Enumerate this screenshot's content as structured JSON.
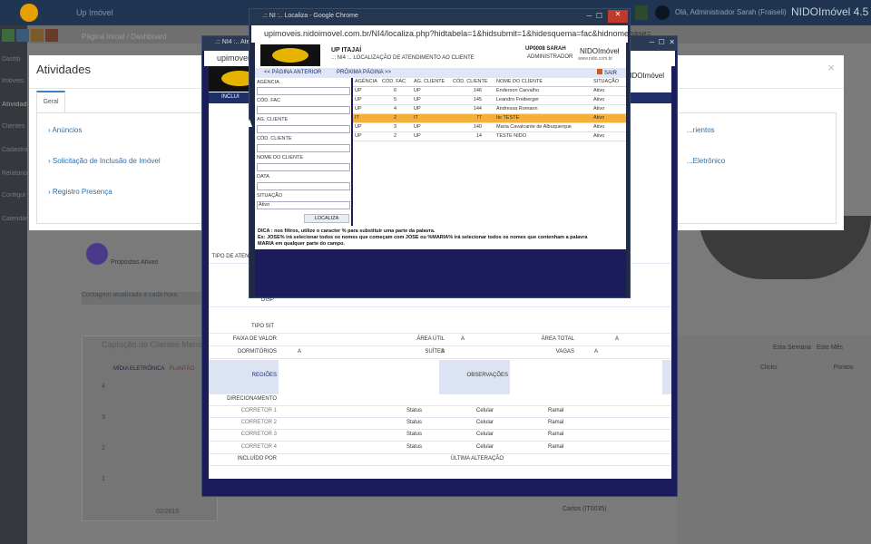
{
  "bg": {
    "title": "Up Imóvel",
    "user": "Olá, Administrador Sarah (Fraiseli)",
    "brand": "NIDOImóvel 4.5",
    "breadcrumb": "Página Inicial / Dashboard",
    "sidebar_items": [
      "Dashb",
      "Imóveis",
      "Atividades",
      "Clientes",
      "Cadastros",
      "Relatórios",
      "Configur",
      "Calendário"
    ],
    "propostas": "Propostas Ativas",
    "info_text": "Contagem atualizada a cada hora",
    "chart_title": "Captação de Clientes Mensal",
    "legend": [
      "MÍDIA ELETRÔNICA",
      "PLANTÃO"
    ],
    "yticks": [
      "4",
      "3",
      "2",
      "1",
      "0"
    ],
    "xticks": [
      "02/2015",
      "04/2015",
      "06/2015"
    ],
    "right_tabs": [
      "Esta Semana",
      "Este Mês"
    ],
    "right_cols": [
      "Clicks",
      "Pontos"
    ],
    "carlos": "Carlos (IT0035)"
  },
  "ativ": {
    "title": "Atividades",
    "close": "×",
    "tab": "Geral",
    "links": [
      "Anúncios",
      "Solicitação de Inclusão de Imóvel",
      "Registro Presença"
    ],
    "right_links": [
      "...rientos",
      "...Eletrônico"
    ]
  },
  "win2": {
    "title": ".:: NI4 :.. Atendimento ::.",
    "url": "upimoveis.nidoimovel.com.br/NI4/atendimento.php",
    "incl": "INCLUI",
    "sair": "SAIR",
    "brand": "NIDOImóvel",
    "rows": {
      "tipo_atend": "TIPO DE ATENDIMENTO",
      "disp": "DISP",
      "tipo_sit": "TIPO SIT",
      "faixa": "FAIXA DE VALOR",
      "area_util": "ÁREA ÚTIL",
      "area_total": "ÁREA TOTAL",
      "dormitorios": "DORMITÓRIOS",
      "suites": "SUÍTES",
      "vagas": "VAGAS",
      "regioes": "REGIÕES",
      "observacoes": "OBSERVAÇÕES",
      "direcionamento": "DIRECIONAMENTO",
      "incluido_por": "INCLUÍDO POR",
      "ultima_alteracao": "ÚLTIMA ALTERAÇÃO",
      "a": "A"
    },
    "correctors": [
      {
        "label": "CORRETOR 1",
        "status": "Status",
        "celular": "Celular",
        "ramal": "Ramal"
      },
      {
        "label": "CORRETOR 2",
        "status": "Status",
        "celular": "Celular",
        "ramal": "Ramal"
      },
      {
        "label": "CORRETOR 3",
        "status": "Status",
        "celular": "Celular",
        "ramal": "Ramal"
      },
      {
        "label": "CORRETOR 4",
        "status": "Status",
        "celular": "Celular",
        "ramal": "Ramal"
      }
    ]
  },
  "popup": {
    "title": ".:: NI :.. Localiza - Google Chrome",
    "url": "upimoveis.nidoimovel.com.br/NI4/localiza.php?hidtabela=1&hidsubmit=1&hidesquema=fac&hidnomebase=",
    "company": "UP ITAJAÍ",
    "subtitle": "..: NI4 :.. LOCALIZAÇÃO DE ATENDIMENTO AO CLIENTE",
    "user": "UP0008 SARAH",
    "role": "ADMINISTRADOR",
    "brand": "NIDOImóvel",
    "site": "www.nido.com.br",
    "prev": "<< PÁGINA ANTERIOR",
    "next": "PRÓXIMA PÁGINA >>",
    "sair": "SAIR",
    "form": {
      "agencia": "AGÊNCIA",
      "cod_fac": "CÓD. FAC",
      "ag_cliente": "AG. CLIENTE",
      "cod_cliente": "CÓD. CLIENTE",
      "nome_cliente": "NOME DO CLIENTE",
      "data": "DATA",
      "situacao": "SITUAÇÃO",
      "situacao_value": "Ativo",
      "localiza": "LOCALIZA"
    },
    "table": {
      "headers": [
        "AGÊNCIA",
        "CÓD. FAC",
        "AG. CLIENTE",
        "CÓD. CLIENTE",
        "NOME DO CLIENTE",
        "SITUAÇÃO"
      ],
      "rows": [
        [
          "UP",
          "6",
          "UP",
          "146",
          "Enderson Carvalho",
          "Ativo"
        ],
        [
          "UP",
          "5",
          "UP",
          "145",
          "Leandro Freiberger",
          "Ativo"
        ],
        [
          "UP",
          "4",
          "UP",
          "144",
          "Andressa Romann",
          "Ativo"
        ],
        [
          "IT",
          "2",
          "IT",
          "77",
          "Ite TESTE",
          "Ativo"
        ],
        [
          "UP",
          "3",
          "UP",
          "140",
          "Maria Cavalcante de Albuquerque",
          "Ativo"
        ],
        [
          "UP",
          "2",
          "UP",
          "14",
          "TESTE NIDO",
          "Ativo"
        ]
      ],
      "selected_row": 3
    },
    "tip1": "DICA : nos filtros, utilize o caracter % para substituir uma parte da palavra.",
    "tip2": "Ex: JOSE% irá selecionar todos os nomes que começam com JOSE ou %MARIA% irá selecionar todos os nomes que contenham a palavra",
    "tip3": "MARIA em qualquer parte do campo."
  }
}
